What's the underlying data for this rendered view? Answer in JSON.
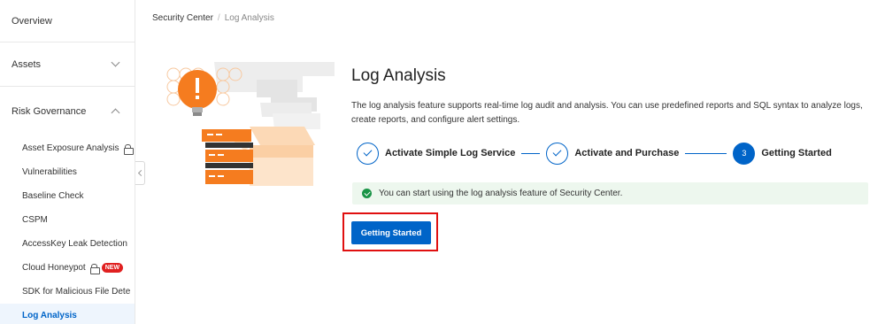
{
  "sidebar": {
    "overview_label": "Overview",
    "assets_label": "Assets",
    "risk_governance_label": "Risk Governance",
    "items": [
      {
        "label": "Asset Exposure Analysis",
        "locked": true
      },
      {
        "label": "Vulnerabilities"
      },
      {
        "label": "Baseline Check"
      },
      {
        "label": "CSPM"
      },
      {
        "label": "AccessKey Leak Detection"
      },
      {
        "label": "Cloud Honeypot",
        "locked": true,
        "badge": "NEW"
      },
      {
        "label": "SDK for Malicious File Dete"
      },
      {
        "label": "Log Analysis",
        "active": true
      }
    ]
  },
  "breadcrumb": {
    "root": "Security Center",
    "separator": "/",
    "current": "Log Analysis"
  },
  "page": {
    "title": "Log Analysis",
    "description": "The log analysis feature supports real-time log audit and analysis. You can use predefined reports and SQL syntax to analyze logs, create reports, and configure alert settings."
  },
  "steps": [
    {
      "label": "Activate Simple Log Service",
      "status": "done"
    },
    {
      "label": "Activate and Purchase",
      "status": "done"
    },
    {
      "label": "Getting Started",
      "status": "current",
      "number": "3"
    }
  ],
  "alert": {
    "message": "You can start using the log analysis feature of Security Center."
  },
  "action": {
    "button_label": "Getting Started"
  },
  "colors": {
    "primary": "#0064c8",
    "success": "#1a9447",
    "highlight": "#e01010",
    "accent_orange": "#f57c1f"
  }
}
